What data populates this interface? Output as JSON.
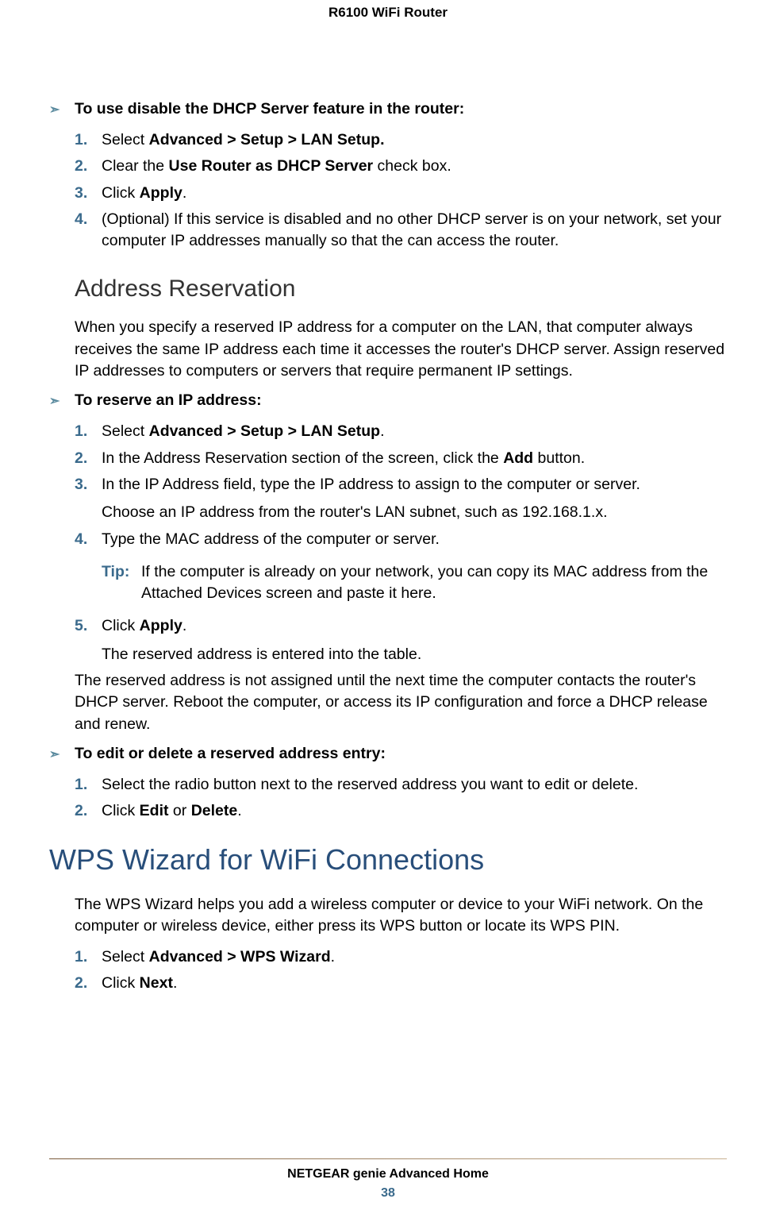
{
  "header": "R6100 WiFi Router",
  "sections": {
    "task1": {
      "heading": "To use disable the DHCP Server feature in the router:",
      "steps": [
        {
          "n": "1.",
          "pre": "Select ",
          "b": "Advanced > Setup > LAN Setup.",
          "post": ""
        },
        {
          "n": "2.",
          "pre": "Clear the ",
          "b": "Use Router as DHCP Server",
          "post": " check box."
        },
        {
          "n": "3.",
          "pre": "Click ",
          "b": "Apply",
          "post": "."
        },
        {
          "n": "4.",
          "pre": "(Optional) If this service is disabled and no other DHCP server is on your network, set your computer IP addresses manually so that the can access the router.",
          "b": "",
          "post": ""
        }
      ]
    },
    "address_reservation": {
      "title": "Address Reservation",
      "intro": "When you specify a reserved IP address for a computer on the LAN, that computer always receives the same IP address each time it accesses the router's DHCP server. Assign reserved IP addresses to computers or servers that require permanent IP settings."
    },
    "task2": {
      "heading": "To reserve an IP address:",
      "steps": [
        {
          "n": "1.",
          "pre": "Select ",
          "b": "Advanced > Setup > LAN Setup",
          "post": "."
        },
        {
          "n": "2.",
          "pre": "In the Address Reservation section of the screen, click the ",
          "b": "Add",
          "post": " button."
        },
        {
          "n": "3.",
          "pre": "In the IP Address field, type the IP address to assign to the computer or server.",
          "b": "",
          "post": "",
          "sub": "Choose an IP address from the router's LAN subnet, such as 192.168.1.x."
        },
        {
          "n": "4.",
          "pre": "Type the MAC address of the computer or server.",
          "b": "",
          "post": ""
        }
      ],
      "tip_label": "Tip:",
      "tip_text": "If the computer is already on your network, you can copy its MAC address from the Attached Devices screen and paste it here.",
      "steps2": [
        {
          "n": "5.",
          "pre": "Click ",
          "b": "Apply",
          "post": ".",
          "sub": "The reserved address is entered into the table."
        }
      ],
      "outro": "The reserved address is not assigned until the next time the computer contacts the router's DHCP server. Reboot the computer, or access its IP configuration and force a DHCP release and renew."
    },
    "task3": {
      "heading": "To edit or delete a reserved address entry:",
      "steps": [
        {
          "n": "1.",
          "pre": "Select the radio button next to the reserved address you want to edit or delete.",
          "b": "",
          "post": ""
        },
        {
          "n": "2.",
          "pre": "Click ",
          "b": "Edit",
          "post": " or ",
          "b2": "Delete",
          "post2": "."
        }
      ]
    },
    "wps": {
      "title": "WPS Wizard for WiFi Connections",
      "intro": "The WPS Wizard helps you add a wireless computer or device to your WiFi network. On the computer or wireless device, either press its WPS button or locate its WPS PIN.",
      "steps": [
        {
          "n": "1.",
          "pre": "Select ",
          "b": "Advanced > WPS Wizard",
          "post": "."
        },
        {
          "n": "2.",
          "pre": "Click ",
          "b": "Next",
          "post": "."
        }
      ]
    }
  },
  "footer": {
    "title": "NETGEAR genie Advanced Home",
    "page": "38"
  }
}
